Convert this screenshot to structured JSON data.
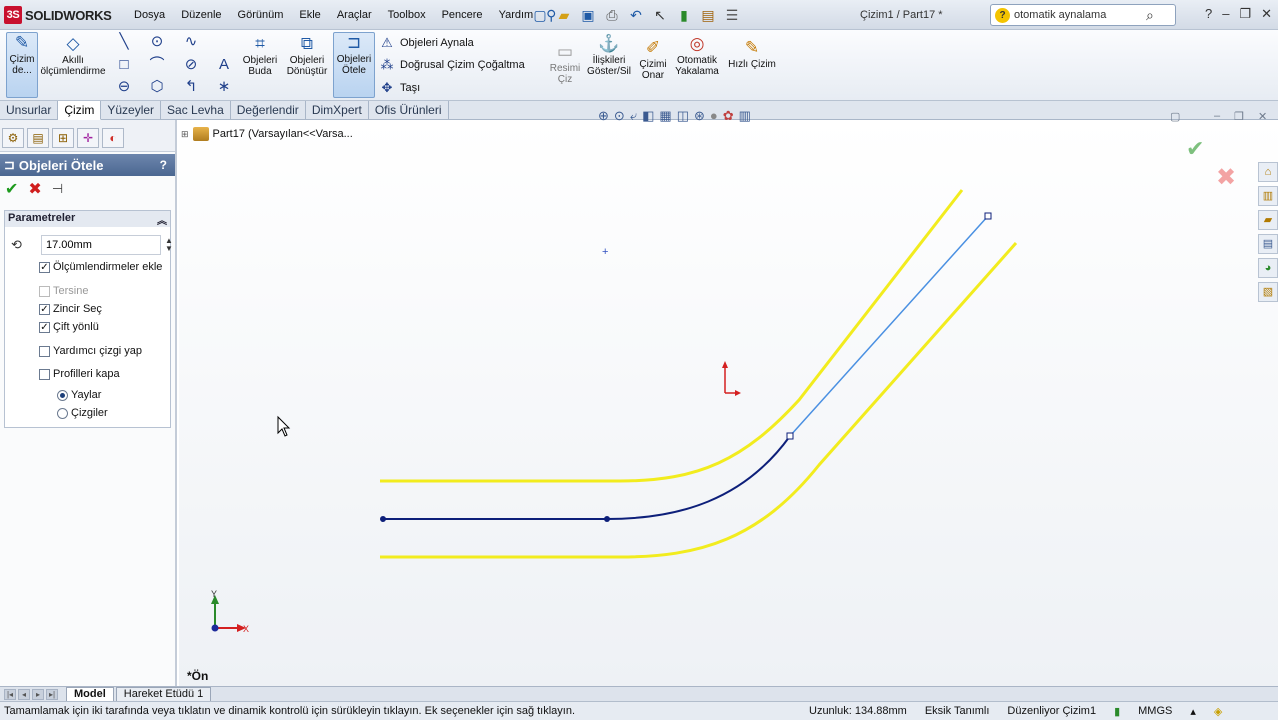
{
  "app": {
    "brand": "SOLIDWORKS",
    "document_title": "Çizim1 / Part17 *"
  },
  "menu": [
    "Dosya",
    "Düzenle",
    "Görünüm",
    "Ekle",
    "Araçlar",
    "Toolbox",
    "Pencere",
    "Yardım"
  ],
  "search": {
    "value": "otomatik aynalama"
  },
  "ribbon": {
    "sketch": "Çizim de...",
    "smart_dimension": "Akıllı ölçümlendirme",
    "trim": "Objeleri Buda",
    "convert": "Objeleri Dönüştür",
    "offset": "Objeleri Ötele",
    "mirror": "Objeleri Aynala",
    "linear_pattern": "Doğrusal Çizim Çoğaltma",
    "move": "Taşı",
    "sketch_picture": "Resimi Çiz",
    "relations": "İlişkileri Göster/Sil",
    "repair": "Çizimi Onar",
    "quick_snaps": "Otomatik Yakalama",
    "rapid_sketch": "Hızlı Çizim"
  },
  "tabs": [
    "Unsurlar",
    "Çizim",
    "Yüzeyler",
    "Sac Levha",
    "Değerlendir",
    "DimXpert",
    "Ofis Ürünleri"
  ],
  "active_tab": "Çizim",
  "property_manager": {
    "title": "Objeleri Ötele",
    "help": "?",
    "group": "Parametreler",
    "distance": "17.00mm",
    "options": [
      {
        "label": "Ölçümlendirmeler ekle",
        "checked": true,
        "enabled": true
      },
      {
        "label": "Tersine",
        "checked": false,
        "enabled": false
      },
      {
        "label": "Zincir Seç",
        "checked": true,
        "enabled": true
      },
      {
        "label": "Çift yönlü",
        "checked": true,
        "enabled": true
      },
      {
        "label": "Yardımcı çizgi yap",
        "checked": false,
        "enabled": true
      },
      {
        "label": "Profilleri kapa",
        "checked": false,
        "enabled": true
      }
    ],
    "cap_ends": [
      {
        "label": "Yaylar",
        "selected": true
      },
      {
        "label": "Çizgiler",
        "selected": false
      }
    ]
  },
  "tree": {
    "root": "Part17  (Varsayılan<<Varsa..."
  },
  "view": {
    "orientation": "*Ön",
    "axis_x": "X",
    "axis_y": "Y"
  },
  "sketch_colors": {
    "offset": "#f2ec1e",
    "selected_chain": "#0d1f7a",
    "construction": "#4a90e2",
    "origin": "#d42020"
  },
  "bottom_tabs": [
    "Model",
    "Hareket Etüdü 1"
  ],
  "status": {
    "message": "Tamamlamak için iki tarafında veya tıklatın ve dinamik kontrolü için sürükleyin tıklayın. Ek seçenekler için sağ tıklayın.",
    "length": "Uzunluk: 134.88mm",
    "definition": "Eksik Tanımlı",
    "mode": "Düzenliyor Çizim1",
    "units": "MMGS"
  }
}
